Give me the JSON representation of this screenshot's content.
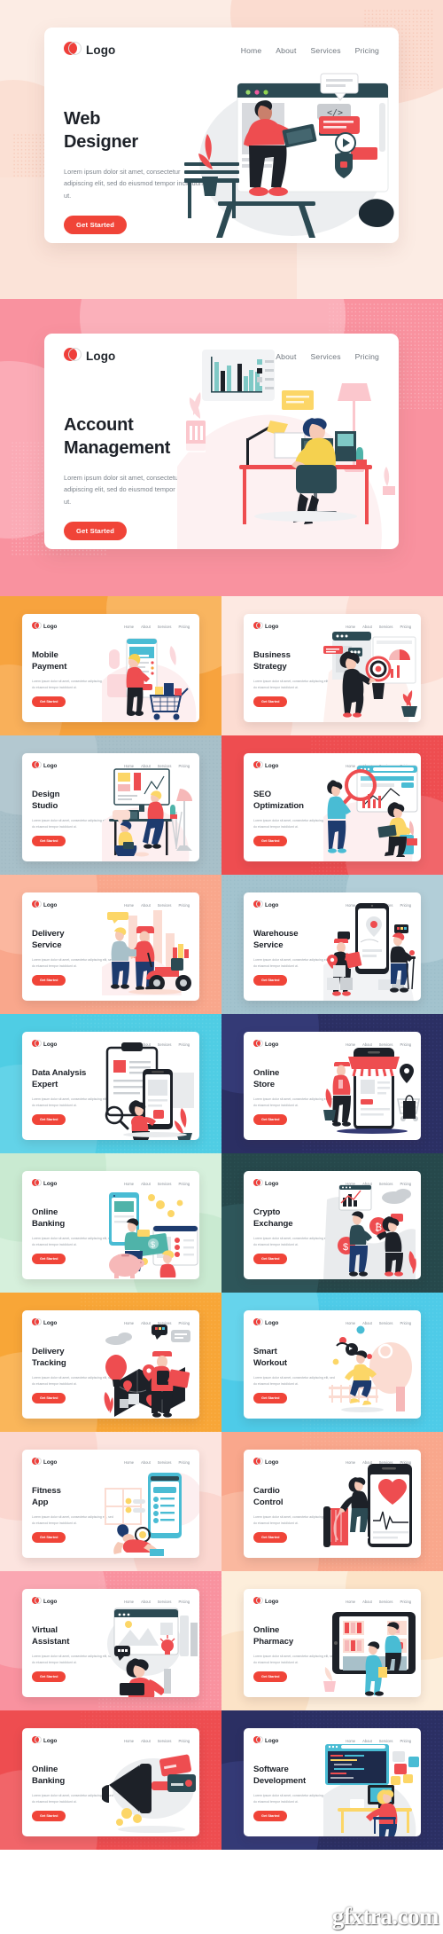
{
  "brand": {
    "logo_text": "Logo",
    "accent": "#f04438",
    "logo_circle_color": "#ef3f3a",
    "heading_color": "#1d2128"
  },
  "nav": {
    "items": [
      "Home",
      "About",
      "Services",
      "Pricing"
    ]
  },
  "common": {
    "body_text": "Lorem ipsum dolor sit amet, consectetur adipiscing elit, sed do eiusmod tempor incididunt ut.",
    "cta_label": "Get Started"
  },
  "heroes": [
    {
      "title_line1": "Web",
      "title_line2": "Designer",
      "body": "Lorem ipsum dolor sit amet, consectetur adipiscing elit, sed do eiusmod tempor incididunt ut.",
      "cta": "Get Started",
      "bg": "#fcece4",
      "accent_shape": "#fbdcd0"
    },
    {
      "title_line1": "Account",
      "title_line2": "Management",
      "body": "Lorem ipsum dolor sit amet, consectetur adipiscing elit, sed do eiusmod tempor incididunt ut.",
      "cta": "Get Started",
      "bg": "#f9929f",
      "accent_shape": "#fbb0ba"
    }
  ],
  "cards": [
    {
      "title_line1": "Mobile",
      "title_line2": "Payment",
      "bg": "#f7a33e",
      "shape": "#f9b560",
      "art": "mobile-payment"
    },
    {
      "title_line1": "Business",
      "title_line2": "Strategy",
      "bg": "#fde9e2",
      "shape": "#fcdcd2",
      "art": "business-strategy"
    },
    {
      "title_line1": "Design",
      "title_line2": "Studio",
      "bg": "#a8c0c9",
      "shape": "#b5cbd3",
      "art": "design-studio"
    },
    {
      "title_line1": "SEO",
      "title_line2": "Optimization",
      "bg": "#ee4d50",
      "shape": "#f1666a",
      "art": "seo-optimization"
    },
    {
      "title_line1": "Delivery",
      "title_line2": "Service",
      "bg": "#f9a78c",
      "shape": "#fbb79f",
      "art": "delivery-service"
    },
    {
      "title_line1": "Warehouse",
      "title_line2": "Service",
      "bg": "#a3c3ce",
      "shape": "#b2ced8",
      "art": "warehouse-service"
    },
    {
      "title_line1": "Data Analysis",
      "title_line2": "Expert",
      "bg": "#4fcde4",
      "shape": "#68d5e9",
      "art": "data-analysis"
    },
    {
      "title_line1": "Online",
      "title_line2": "Store",
      "bg": "#2b2f63",
      "shape": "#343a76",
      "art": "online-store"
    },
    {
      "title_line1": "Online",
      "title_line2": "Banking",
      "bg": "#d6f0dc",
      "shape": "#c8ead1",
      "art": "online-banking"
    },
    {
      "title_line1": "Crypto",
      "title_line2": "Exchange",
      "bg": "#26484b",
      "shape": "#2e565a",
      "art": "crypto-exchange"
    },
    {
      "title_line1": "Delivery",
      "title_line2": "Tracking",
      "bg": "#f8a637",
      "shape": "#fab65a",
      "art": "delivery-tracking"
    },
    {
      "title_line1": "Smart",
      "title_line2": "Workout",
      "bg": "#4ecbe8",
      "shape": "#66d4ec",
      "art": "smart-workout"
    },
    {
      "title_line1": "Fitness",
      "title_line2": "App",
      "bg": "#fce4df",
      "shape": "#fbd7d0",
      "art": "fitness-app"
    },
    {
      "title_line1": "Cardio",
      "title_line2": "Control",
      "bg": "#f9a78c",
      "shape": "#fab89f",
      "art": "cardio-control"
    },
    {
      "title_line1": "Virtual",
      "title_line2": "Assistant",
      "bg": "#f9929f",
      "shape": "#faa7b2",
      "art": "virtual-assistant"
    },
    {
      "title_line1": "Online",
      "title_line2": "Pharmacy",
      "bg": "#fdeedb",
      "shape": "#fce3c7",
      "art": "online-pharmacy"
    },
    {
      "title_line1": "Online",
      "title_line2": "Banking",
      "bg": "#ee4d50",
      "shape": "#f16569",
      "art": "online-banking-2"
    },
    {
      "title_line1": "Software",
      "title_line2": "Development",
      "bg": "#2b2f63",
      "shape": "#343a76",
      "art": "software-development"
    }
  ],
  "watermark": "gfxtra.com"
}
